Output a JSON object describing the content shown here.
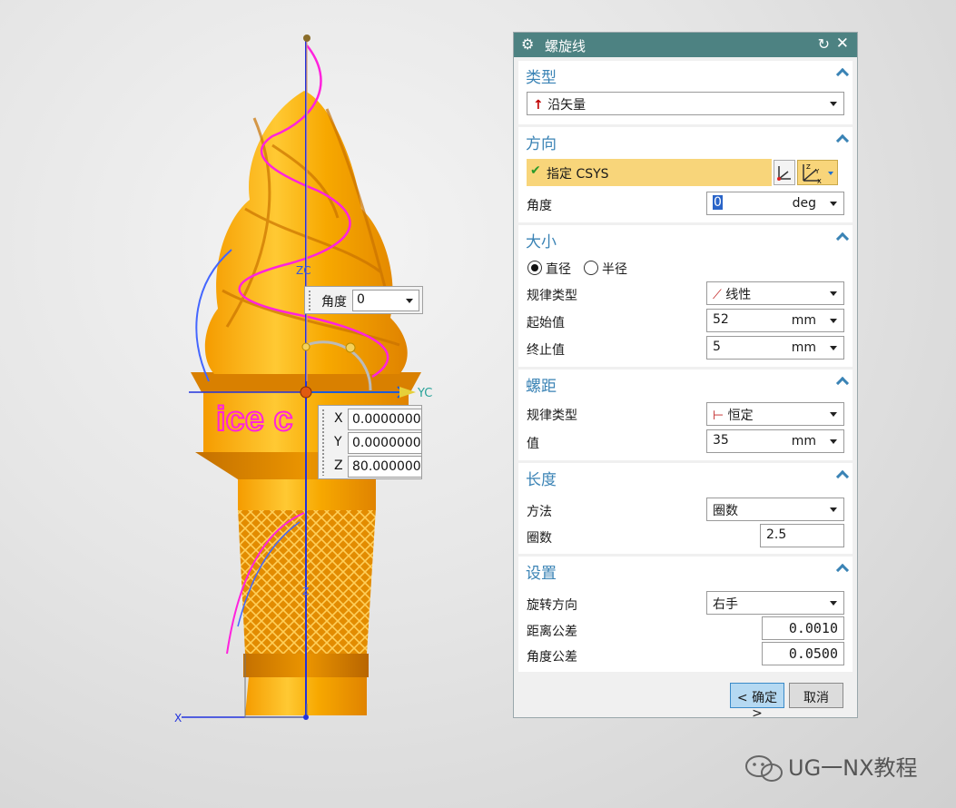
{
  "viewport": {
    "embossed_text": "ice c",
    "axis_zc": "ZC",
    "axis_yc": "YC",
    "axis_x": "X",
    "axis_z": "Z",
    "angle_handle": {
      "label": "角度",
      "value": "0"
    },
    "coord_handle": {
      "x_label": "X",
      "x_value": "0.0000000",
      "y_label": "Y",
      "y_value": "0.0000000",
      "z_label": "Z",
      "z_value": "80.000000"
    },
    "colors": {
      "cone": "#f5a300",
      "helix": "#ff22dd",
      "vector": "#2233dd",
      "guide": "#4466ff"
    }
  },
  "dialog": {
    "title": "螺旋线",
    "sections": {
      "type": {
        "title": "类型",
        "value": "沿矢量"
      },
      "direction": {
        "title": "方向",
        "specify_csys": "指定 CSYS",
        "angle_label": "角度",
        "angle_value": "0",
        "angle_unit": "deg"
      },
      "size": {
        "title": "大小",
        "diameter": "直径",
        "radius": "半径",
        "selected": "直径",
        "law_type_label": "规律类型",
        "law_type_value": "线性",
        "start_label": "起始值",
        "start_value": "52",
        "start_unit": "mm",
        "end_label": "终止值",
        "end_value": "5",
        "end_unit": "mm"
      },
      "pitch": {
        "title": "螺距",
        "law_type_label": "规律类型",
        "law_type_value": "恒定",
        "value_label": "值",
        "value": "35",
        "unit": "mm"
      },
      "length": {
        "title": "长度",
        "method_label": "方法",
        "method_value": "圈数",
        "turns_label": "圈数",
        "turns_value": "2.5"
      },
      "settings": {
        "title": "设置",
        "rotation_label": "旋转方向",
        "rotation_value": "右手",
        "dist_tol_label": "距离公差",
        "dist_tol_value": "0.0010",
        "angle_tol_label": "角度公差",
        "angle_tol_value": "0.0500"
      }
    },
    "ok_label": "< 确定 >",
    "cancel_label": "取消"
  },
  "watermark": "UG一NX教程"
}
